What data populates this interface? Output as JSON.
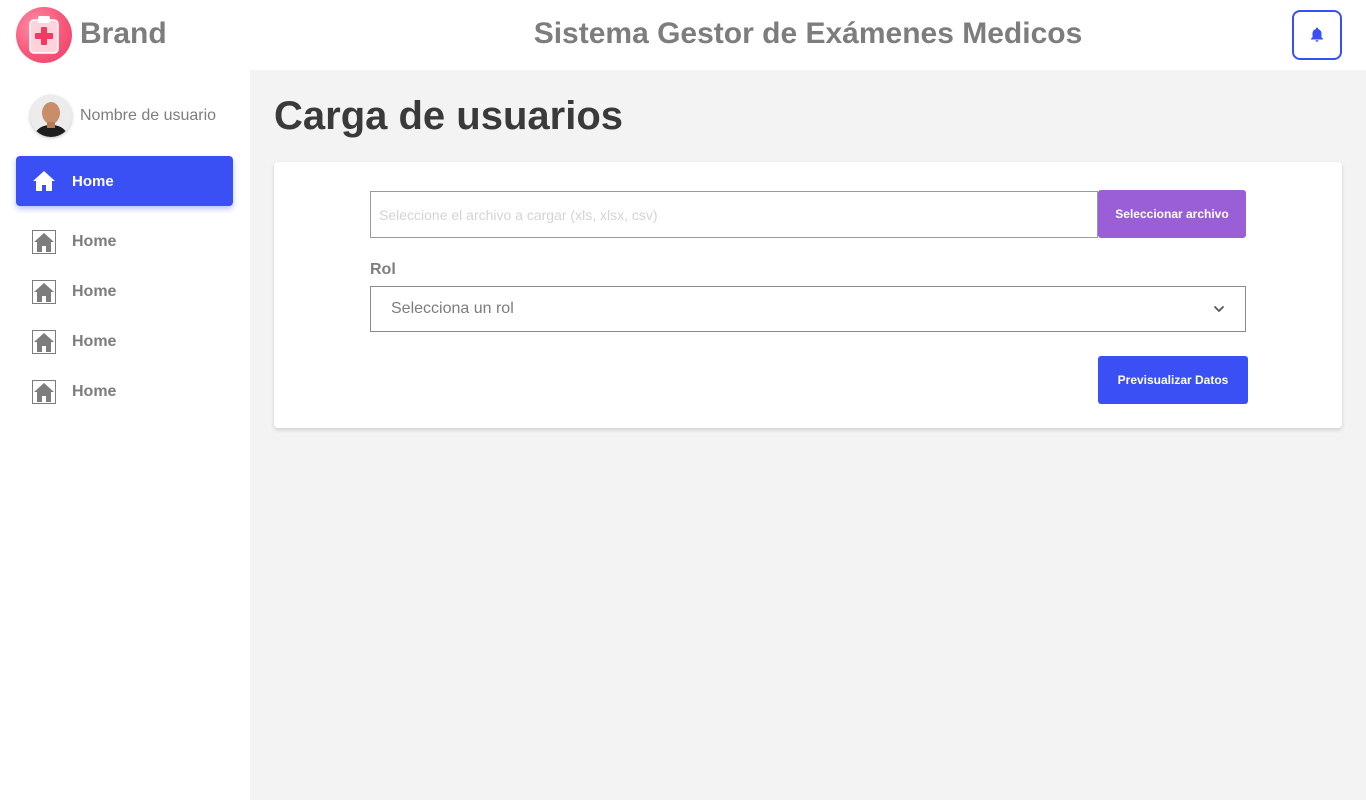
{
  "header": {
    "brand": "Brand",
    "title": "Sistema Gestor de Exámenes Medicos",
    "brand_icon": "clipboard-medical-icon",
    "notification_icon": "bell-icon"
  },
  "sidebar": {
    "user_name": "Nombre de usuario",
    "items": [
      {
        "label": "Home",
        "icon": "home-icon",
        "active": true
      },
      {
        "label": "Home",
        "icon": "home-icon",
        "active": false
      },
      {
        "label": "Home",
        "icon": "home-icon",
        "active": false
      },
      {
        "label": "Home",
        "icon": "home-icon",
        "active": false
      },
      {
        "label": "Home",
        "icon": "home-icon",
        "active": false
      }
    ]
  },
  "main": {
    "page_title": "Carga de usuarios",
    "file_input": {
      "placeholder": "Seleccione el archivo a cargar (xls, xlsx, csv)",
      "value": ""
    },
    "select_file_label": "Seleccionar archivo",
    "role_label": "Rol",
    "role_select": {
      "selected": "Selecciona un rol"
    },
    "preview_label": "Previsualizar Datos"
  },
  "colors": {
    "accent": "#3a50f5",
    "secondary": "#9a5fd6",
    "brand": "#f7577a",
    "background": "#f3f3f3"
  }
}
